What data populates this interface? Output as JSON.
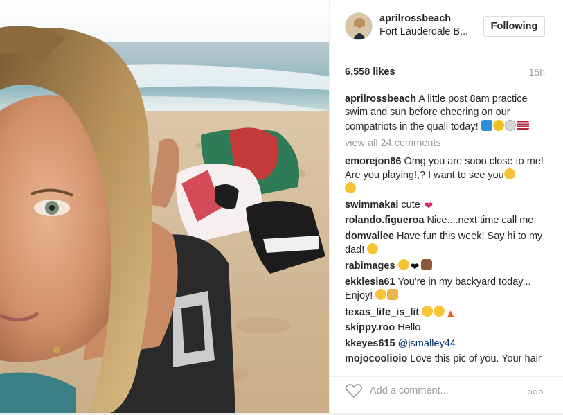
{
  "header": {
    "username": "aprilrossbeach",
    "location": "Fort Lauderdale B...",
    "follow_label": "Following"
  },
  "stats": {
    "likes": "6,558 likes",
    "time_ago": "15h"
  },
  "caption": {
    "user": "aprilrossbeach",
    "text": "A little post 8am practice swim and sun before cheering on our compatriots in the quali today!"
  },
  "view_all_comments": "view all 24 comments",
  "comments": [
    {
      "user": "emorejon86",
      "text": "Omg you are sooo close to me! Are you playing!,? I want to see you"
    },
    {
      "user": "swimmakai",
      "text": "cute"
    },
    {
      "user": "rolando.figueroa",
      "text": "Nice....next time call me."
    },
    {
      "user": "domvallee",
      "text": "Have fun this week! Say hi to my dad!"
    },
    {
      "user": "rabimages",
      "text": ""
    },
    {
      "user": "ekklesia61",
      "text": "You're in my backyard today... Enjoy!"
    },
    {
      "user": "texas_life_is_lit",
      "text": ""
    },
    {
      "user": "skippy.roo",
      "text": "Hello"
    },
    {
      "user": "kkeyes615",
      "text": "@jsmalley44"
    },
    {
      "user": "mojocoolioio",
      "text": "Love this pic of you. Your hair"
    }
  ],
  "footer": {
    "comment_placeholder": "Add a comment..."
  },
  "icons": {
    "like": "heart-icon",
    "more": "more-options-icon"
  },
  "colors": {
    "text": "#262626",
    "muted": "#999999",
    "border": "#efefef",
    "mention": "#003569"
  }
}
